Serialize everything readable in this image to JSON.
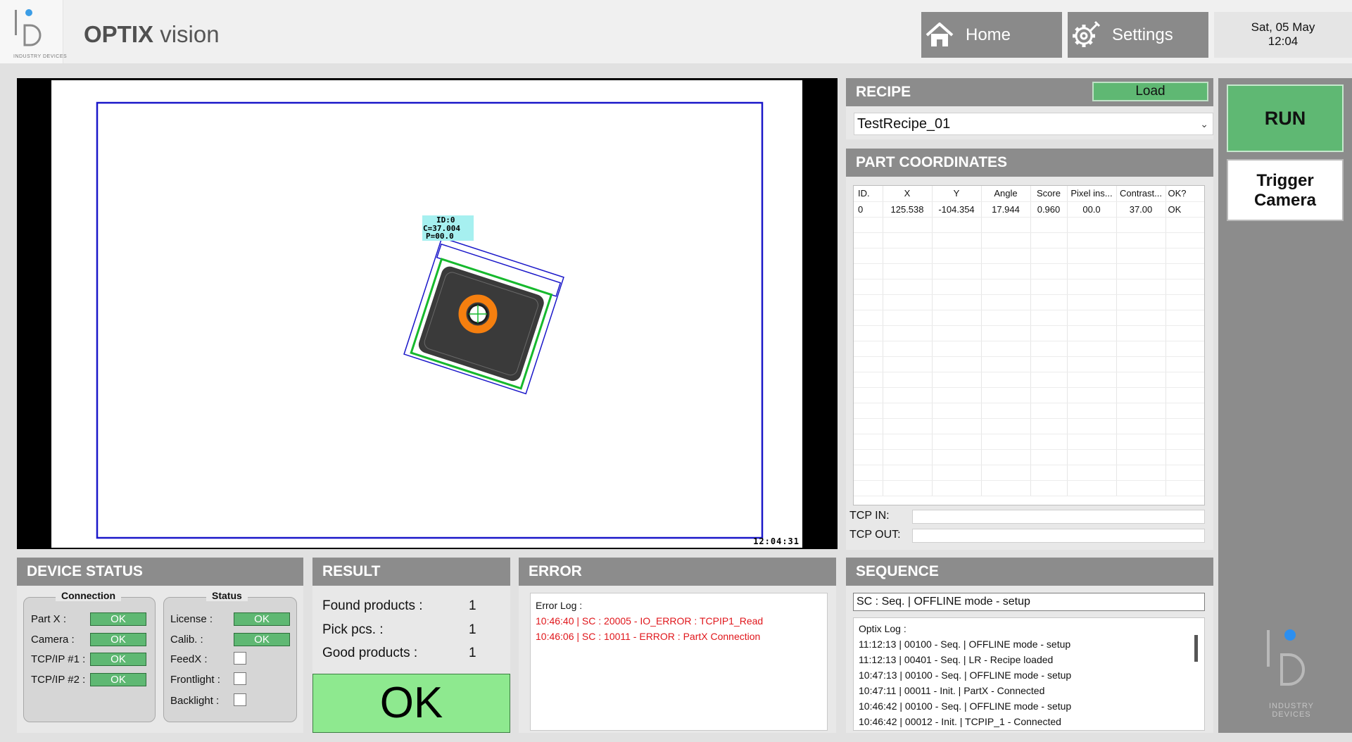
{
  "header": {
    "logo_text": "INDUSTRY DEVICES",
    "title_bold": "OPTIX",
    "title_rest": " vision",
    "home_label": "Home",
    "settings_label": "Settings",
    "date": "Sat, 05 May",
    "time": "12:04"
  },
  "camera": {
    "timestamp": "12:04:31",
    "overlay_lines": [
      "ID:0",
      "C=37.004",
      "P=00.0"
    ]
  },
  "recipe": {
    "title": "RECIPE",
    "load_label": "Load",
    "selected": "TestRecipe_01"
  },
  "coordinates": {
    "title": "PART COORDINATES",
    "columns": [
      "ID.",
      "X",
      "Y",
      "Angle",
      "Score",
      "Pixel ins...",
      "Contrast...",
      "OK?"
    ],
    "rows": [
      [
        "0",
        "125.538",
        "-104.354",
        "17.944",
        "0.960",
        "00.0",
        "37.00",
        "OK"
      ]
    ],
    "tcp_in_label": "TCP IN:",
    "tcp_out_label": "TCP OUT:",
    "tcp_in_value": "",
    "tcp_out_value": ""
  },
  "controls": {
    "run_label": "RUN",
    "trigger_line1": "Trigger",
    "trigger_line2": "Camera",
    "footer_logo_line1": "INDUSTRY",
    "footer_logo_line2": "DEVICES"
  },
  "device_status": {
    "title": "DEVICE STATUS",
    "connection_title": "Connection",
    "status_title": "Status",
    "connection": [
      {
        "label": "Part X :",
        "value": "OK"
      },
      {
        "label": "Camera :",
        "value": "OK"
      },
      {
        "label": "TCP/IP #1 :",
        "value": "OK"
      },
      {
        "label": "TCP/IP #2 :",
        "value": "OK"
      }
    ],
    "status": [
      {
        "label": "License :",
        "value": "OK"
      },
      {
        "label": "Calib. :",
        "value": "OK"
      },
      {
        "label": "FeedX :",
        "value": ""
      },
      {
        "label": "Frontlight :",
        "value": ""
      },
      {
        "label": "Backlight :",
        "value": ""
      }
    ]
  },
  "result": {
    "title": "RESULT",
    "found_label": "Found products :",
    "found_value": "1",
    "pick_label": "Pick pcs. :",
    "pick_value": "1",
    "good_label": "Good products :",
    "good_value": "1",
    "verdict": "OK"
  },
  "error": {
    "title": "ERROR",
    "log_header": "Error Log :",
    "entries": [
      "10:46:40 | SC : 20005 - IO_ERROR : TCPIP1_Read",
      "10:46:06 | SC : 10011 - ERROR : PartX Connection"
    ]
  },
  "sequence": {
    "title": "SEQUENCE",
    "status": "SC : Seq. | OFFLINE mode - setup",
    "log_header": "Optix Log :",
    "entries": [
      "11:12:13 | 00100 - Seq. | OFFLINE mode - setup",
      "11:12:13 | 00401 - Seq. | LR - Recipe loaded",
      "10:47:13 | 00100 - Seq. | OFFLINE mode - setup",
      "10:47:11 | 00011 - Init. | PartX - Connected",
      "10:46:42 | 00100 - Seq. | OFFLINE mode - setup",
      "10:46:42 | 00012 - Init. | TCPIP_1 - Connected"
    ]
  }
}
